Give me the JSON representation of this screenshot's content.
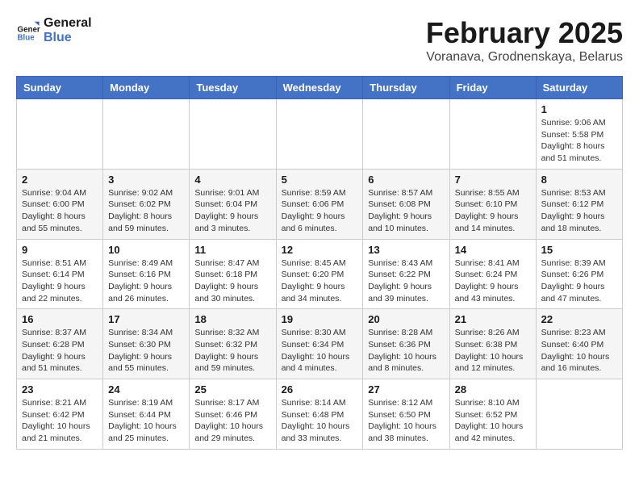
{
  "header": {
    "logo_line1": "General",
    "logo_line2": "Blue",
    "month_title": "February 2025",
    "location": "Voranava, Grodnenskaya, Belarus"
  },
  "weekdays": [
    "Sunday",
    "Monday",
    "Tuesday",
    "Wednesday",
    "Thursday",
    "Friday",
    "Saturday"
  ],
  "weeks": [
    [
      {
        "day": "",
        "info": ""
      },
      {
        "day": "",
        "info": ""
      },
      {
        "day": "",
        "info": ""
      },
      {
        "day": "",
        "info": ""
      },
      {
        "day": "",
        "info": ""
      },
      {
        "day": "",
        "info": ""
      },
      {
        "day": "1",
        "info": "Sunrise: 9:06 AM\nSunset: 5:58 PM\nDaylight: 8 hours and 51 minutes."
      }
    ],
    [
      {
        "day": "2",
        "info": "Sunrise: 9:04 AM\nSunset: 6:00 PM\nDaylight: 8 hours and 55 minutes."
      },
      {
        "day": "3",
        "info": "Sunrise: 9:02 AM\nSunset: 6:02 PM\nDaylight: 8 hours and 59 minutes."
      },
      {
        "day": "4",
        "info": "Sunrise: 9:01 AM\nSunset: 6:04 PM\nDaylight: 9 hours and 3 minutes."
      },
      {
        "day": "5",
        "info": "Sunrise: 8:59 AM\nSunset: 6:06 PM\nDaylight: 9 hours and 6 minutes."
      },
      {
        "day": "6",
        "info": "Sunrise: 8:57 AM\nSunset: 6:08 PM\nDaylight: 9 hours and 10 minutes."
      },
      {
        "day": "7",
        "info": "Sunrise: 8:55 AM\nSunset: 6:10 PM\nDaylight: 9 hours and 14 minutes."
      },
      {
        "day": "8",
        "info": "Sunrise: 8:53 AM\nSunset: 6:12 PM\nDaylight: 9 hours and 18 minutes."
      }
    ],
    [
      {
        "day": "9",
        "info": "Sunrise: 8:51 AM\nSunset: 6:14 PM\nDaylight: 9 hours and 22 minutes."
      },
      {
        "day": "10",
        "info": "Sunrise: 8:49 AM\nSunset: 6:16 PM\nDaylight: 9 hours and 26 minutes."
      },
      {
        "day": "11",
        "info": "Sunrise: 8:47 AM\nSunset: 6:18 PM\nDaylight: 9 hours and 30 minutes."
      },
      {
        "day": "12",
        "info": "Sunrise: 8:45 AM\nSunset: 6:20 PM\nDaylight: 9 hours and 34 minutes."
      },
      {
        "day": "13",
        "info": "Sunrise: 8:43 AM\nSunset: 6:22 PM\nDaylight: 9 hours and 39 minutes."
      },
      {
        "day": "14",
        "info": "Sunrise: 8:41 AM\nSunset: 6:24 PM\nDaylight: 9 hours and 43 minutes."
      },
      {
        "day": "15",
        "info": "Sunrise: 8:39 AM\nSunset: 6:26 PM\nDaylight: 9 hours and 47 minutes."
      }
    ],
    [
      {
        "day": "16",
        "info": "Sunrise: 8:37 AM\nSunset: 6:28 PM\nDaylight: 9 hours and 51 minutes."
      },
      {
        "day": "17",
        "info": "Sunrise: 8:34 AM\nSunset: 6:30 PM\nDaylight: 9 hours and 55 minutes."
      },
      {
        "day": "18",
        "info": "Sunrise: 8:32 AM\nSunset: 6:32 PM\nDaylight: 9 hours and 59 minutes."
      },
      {
        "day": "19",
        "info": "Sunrise: 8:30 AM\nSunset: 6:34 PM\nDaylight: 10 hours and 4 minutes."
      },
      {
        "day": "20",
        "info": "Sunrise: 8:28 AM\nSunset: 6:36 PM\nDaylight: 10 hours and 8 minutes."
      },
      {
        "day": "21",
        "info": "Sunrise: 8:26 AM\nSunset: 6:38 PM\nDaylight: 10 hours and 12 minutes."
      },
      {
        "day": "22",
        "info": "Sunrise: 8:23 AM\nSunset: 6:40 PM\nDaylight: 10 hours and 16 minutes."
      }
    ],
    [
      {
        "day": "23",
        "info": "Sunrise: 8:21 AM\nSunset: 6:42 PM\nDaylight: 10 hours and 21 minutes."
      },
      {
        "day": "24",
        "info": "Sunrise: 8:19 AM\nSunset: 6:44 PM\nDaylight: 10 hours and 25 minutes."
      },
      {
        "day": "25",
        "info": "Sunrise: 8:17 AM\nSunset: 6:46 PM\nDaylight: 10 hours and 29 minutes."
      },
      {
        "day": "26",
        "info": "Sunrise: 8:14 AM\nSunset: 6:48 PM\nDaylight: 10 hours and 33 minutes."
      },
      {
        "day": "27",
        "info": "Sunrise: 8:12 AM\nSunset: 6:50 PM\nDaylight: 10 hours and 38 minutes."
      },
      {
        "day": "28",
        "info": "Sunrise: 8:10 AM\nSunset: 6:52 PM\nDaylight: 10 hours and 42 minutes."
      },
      {
        "day": "",
        "info": ""
      }
    ]
  ]
}
